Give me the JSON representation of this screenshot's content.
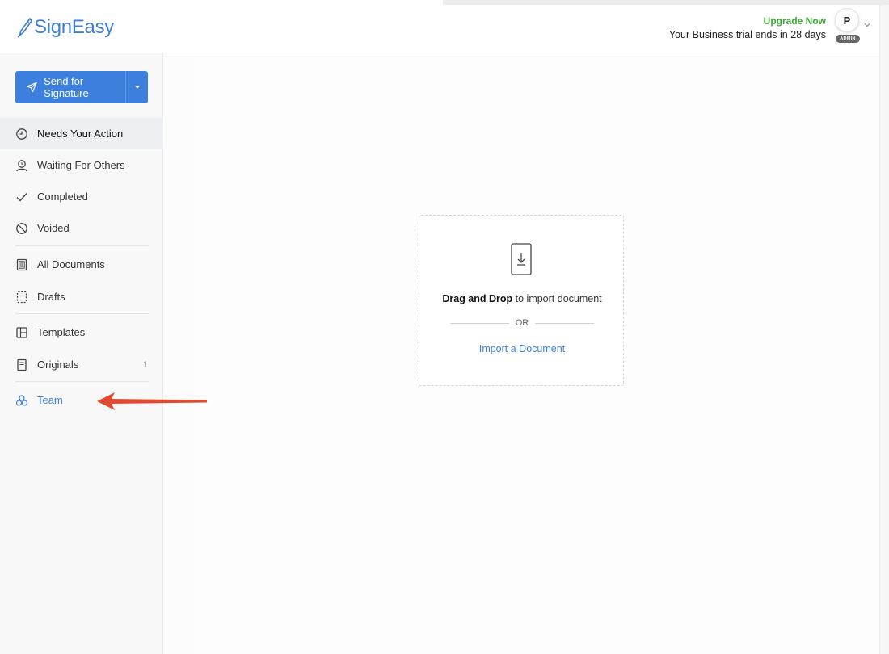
{
  "app": {
    "brand": "SignEasy"
  },
  "header": {
    "upgrade_label": "Upgrade Now",
    "trial_text": "Your Business trial ends in 28 days",
    "avatar_initial": "P",
    "admin_badge": "ADMIN"
  },
  "sidebar": {
    "send_button_label": "Send for Signature",
    "items": [
      {
        "label": "Needs Your Action",
        "icon": "clock-icon",
        "active": true
      },
      {
        "label": "Waiting For Others",
        "icon": "person-wait-icon"
      },
      {
        "label": "Completed",
        "icon": "check-icon"
      },
      {
        "label": "Voided",
        "icon": "void-icon"
      },
      {
        "label": "All Documents",
        "icon": "documents-icon"
      },
      {
        "label": "Drafts",
        "icon": "drafts-icon"
      },
      {
        "label": "Templates",
        "icon": "templates-icon"
      },
      {
        "label": "Originals",
        "icon": "originals-icon",
        "count": "1"
      },
      {
        "label": "Team",
        "icon": "team-icon"
      }
    ]
  },
  "dropzone": {
    "drag_bold": "Drag and Drop",
    "drag_rest": " to import document",
    "or_text": "OR",
    "import_link": "Import a Document"
  },
  "colors": {
    "brand_blue": "#3d7fdc",
    "upgrade_green": "#3fa63a",
    "annotation_arrow": "#e04a32"
  }
}
